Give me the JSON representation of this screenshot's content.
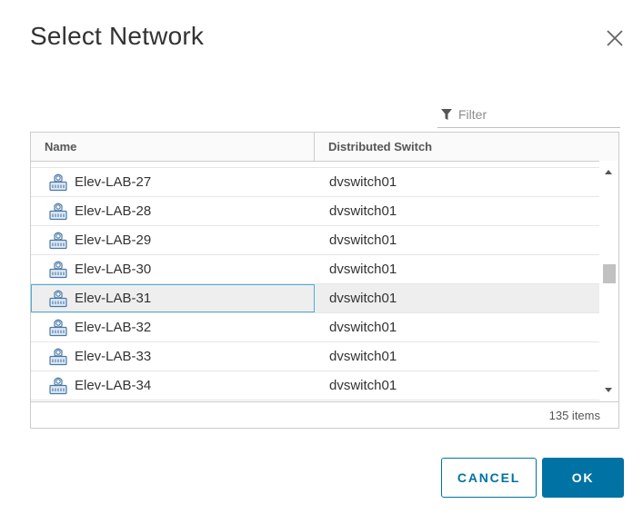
{
  "dialog": {
    "title": "Select Network"
  },
  "filter": {
    "placeholder": "Filter",
    "value": ""
  },
  "table": {
    "columns": [
      "Name",
      "Distributed Switch"
    ],
    "rows": [
      {
        "name": "Elev-LAB-27",
        "switch": "dvswitch01",
        "selected": false
      },
      {
        "name": "Elev-LAB-28",
        "switch": "dvswitch01",
        "selected": false
      },
      {
        "name": "Elev-LAB-29",
        "switch": "dvswitch01",
        "selected": false
      },
      {
        "name": "Elev-LAB-30",
        "switch": "dvswitch01",
        "selected": false
      },
      {
        "name": "Elev-LAB-31",
        "switch": "dvswitch01",
        "selected": true
      },
      {
        "name": "Elev-LAB-32",
        "switch": "dvswitch01",
        "selected": false
      },
      {
        "name": "Elev-LAB-33",
        "switch": "dvswitch01",
        "selected": false
      },
      {
        "name": "Elev-LAB-34",
        "switch": "dvswitch01",
        "selected": false
      }
    ],
    "row_icon": "distributed-port-group-icon",
    "footer": "135 items"
  },
  "buttons": {
    "cancel": "CANCEL",
    "ok": "OK"
  },
  "colors": {
    "primary": "#0072a3",
    "selection_outline": "#49afd9",
    "selected_row_bg": "#eeeeee"
  }
}
